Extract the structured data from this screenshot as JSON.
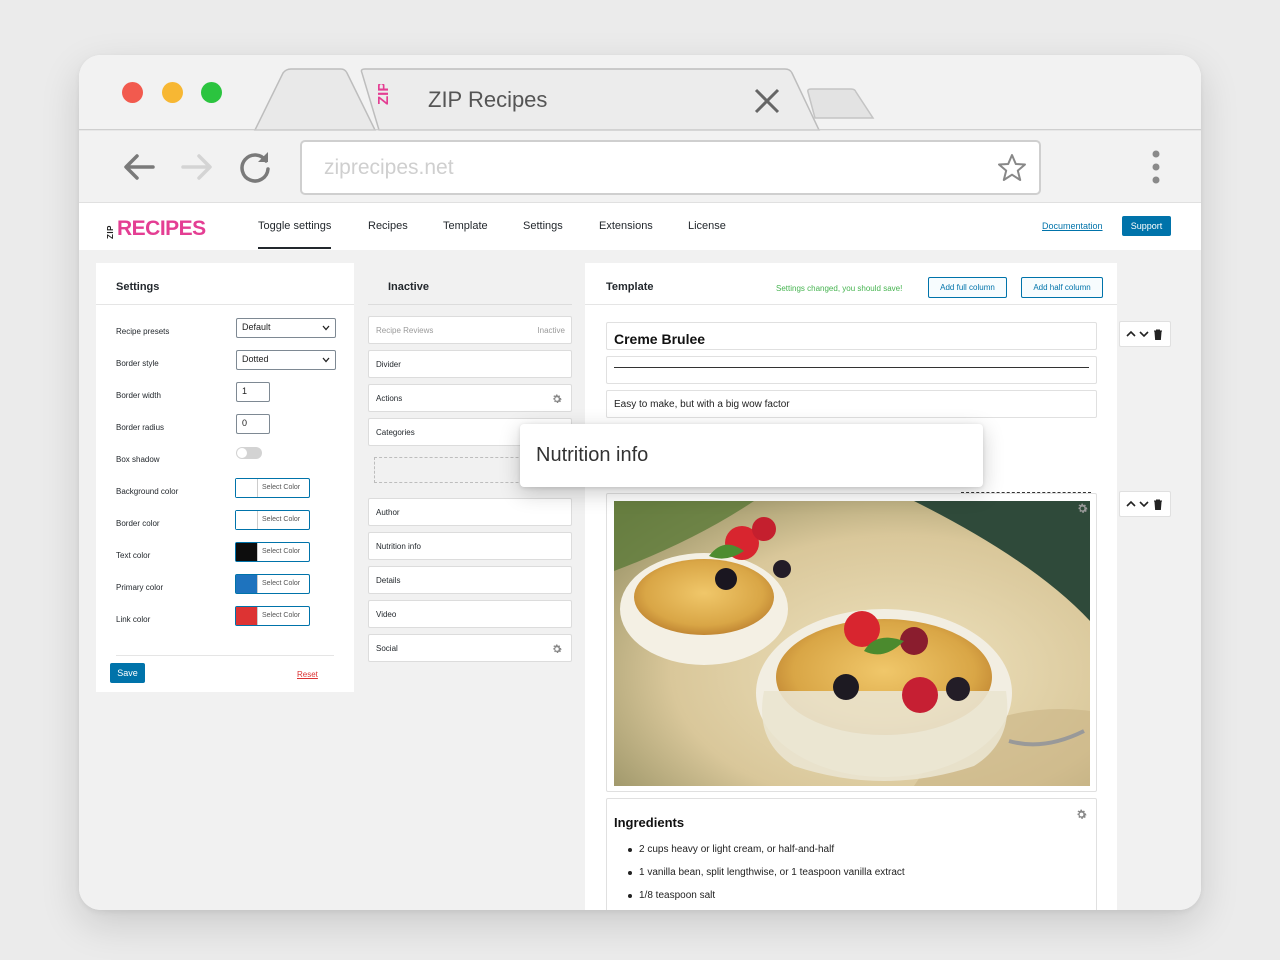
{
  "browser": {
    "tab_title": "ZIP Recipes",
    "tab_logo_text": "ZIP",
    "url": "ziprecipes.net"
  },
  "brand": {
    "prefix": "ZIP",
    "name": "RECIPES",
    "color": "#e43e93"
  },
  "nav": {
    "items": [
      "Toggle settings",
      "Recipes",
      "Template",
      "Settings",
      "Extensions",
      "License"
    ],
    "active": "Toggle settings",
    "documentation": "Documentation",
    "support": "Support"
  },
  "settings": {
    "title": "Settings",
    "recipe_presets": {
      "label": "Recipe presets",
      "value": "Default"
    },
    "border_style": {
      "label": "Border style",
      "value": "Dotted"
    },
    "border_width": {
      "label": "Border width",
      "value": "1"
    },
    "border_radius": {
      "label": "Border radius",
      "value": "0"
    },
    "box_shadow": {
      "label": "Box shadow",
      "enabled": false
    },
    "colors": [
      {
        "label": "Background color",
        "color": "#ffffff",
        "button": "Select Color"
      },
      {
        "label": "Border color",
        "color": "#ffffff",
        "button": "Select Color"
      },
      {
        "label": "Text color",
        "color": "#0d0d0d",
        "button": "Select Color"
      },
      {
        "label": "Primary color",
        "color": "#1e73be",
        "button": "Select Color"
      },
      {
        "label": "Link color",
        "color": "#dd3333",
        "button": "Select Color"
      }
    ],
    "save": "Save",
    "reset": "Reset"
  },
  "inactive": {
    "title": "Inactive",
    "items": [
      {
        "label": "Recipe Reviews",
        "state": "Inactive"
      },
      {
        "label": "Divider"
      },
      {
        "label": "Actions"
      },
      {
        "label": "Categories"
      },
      {
        "label": "Author"
      },
      {
        "label": "Nutrition info"
      },
      {
        "label": "Details"
      },
      {
        "label": "Video"
      },
      {
        "label": "Social"
      }
    ]
  },
  "template": {
    "title": "Template",
    "notice": "Settings changed, you should save!",
    "add_full": "Add full column",
    "add_half": "Add half column",
    "recipe_title": "Creme Brulee",
    "summary": "Easy to make, but with a big wow factor",
    "ingredients_title": "Ingredients",
    "ingredients": [
      "2 cups heavy or light cream, or half-and-half",
      "1 vanilla bean, split lengthwise, or 1 teaspoon vanilla extract",
      "1/8 teaspoon salt"
    ]
  },
  "drag_card": {
    "label": "Nutrition info"
  }
}
